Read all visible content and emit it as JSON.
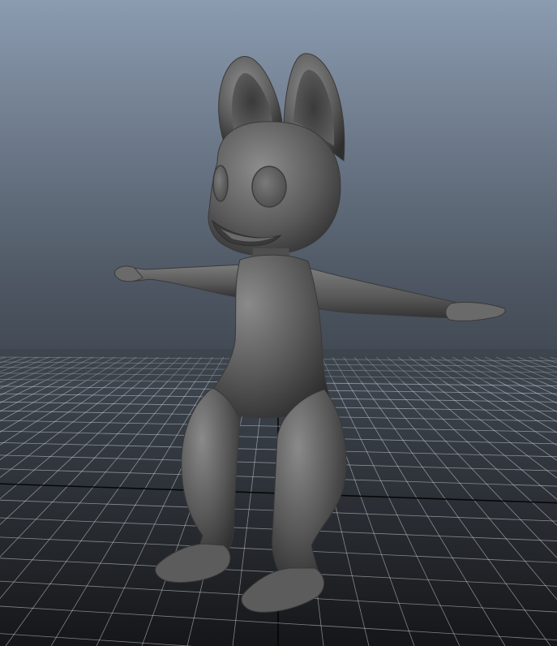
{
  "viewport": {
    "background_top_color": "#8b9bb0",
    "background_bottom_color": "#151618",
    "grid_line_color": "#d6d8dc",
    "grid_axis_color": "#000000",
    "model_color": "#595959",
    "model_shadow_color": "#2c2c2c",
    "model_highlight_color": "#8a8a8a"
  }
}
